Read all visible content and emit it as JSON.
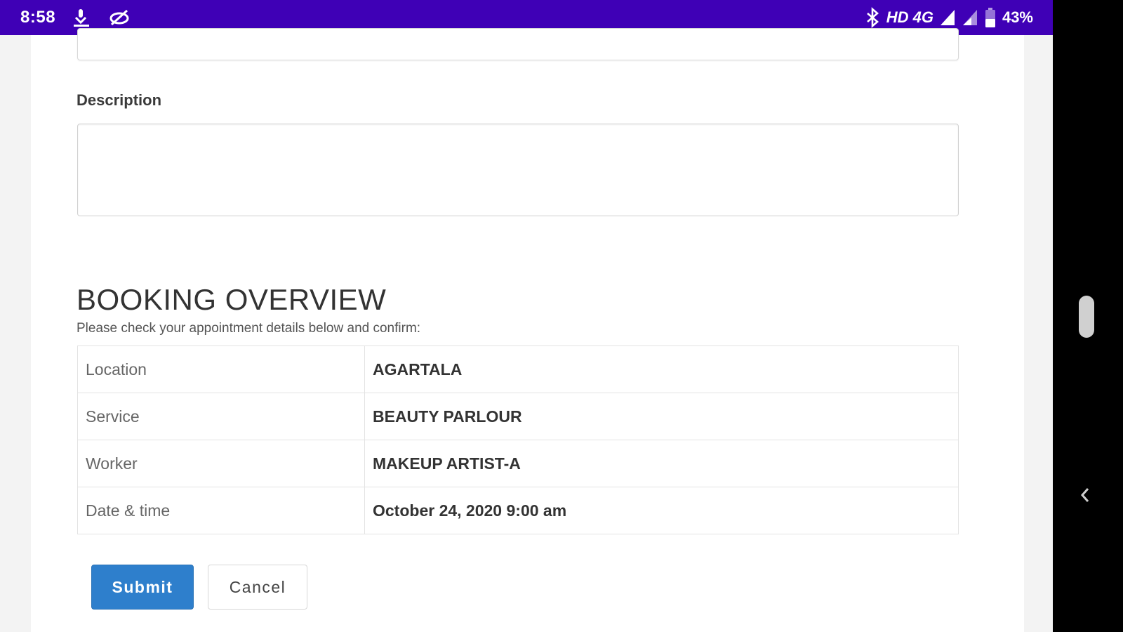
{
  "status_bar": {
    "time": "8:58",
    "network_label": "HD 4G",
    "battery_percent": "43%",
    "icons": [
      "download-icon",
      "crossed-link-icon",
      "bluetooth-icon",
      "signal-icon",
      "signal-icon",
      "battery-icon"
    ]
  },
  "form": {
    "description_label": "Description",
    "description_value": "",
    "top_input_value": ""
  },
  "overview": {
    "title": "BOOKING OVERVIEW",
    "subtitle": "Please check your appointment details below and confirm:",
    "rows": [
      {
        "label": "Location",
        "value": "AGARTALA"
      },
      {
        "label": "Service",
        "value": "BEAUTY PARLOUR"
      },
      {
        "label": "Worker",
        "value": "MAKEUP ARTIST-A"
      },
      {
        "label": "Date & time",
        "value": "October 24, 2020 9:00 am"
      }
    ]
  },
  "buttons": {
    "submit_label": "Submit",
    "cancel_label": "Cancel"
  },
  "colors": {
    "status_bar": "#3f00b6",
    "submit_button": "#2e7fcc"
  }
}
